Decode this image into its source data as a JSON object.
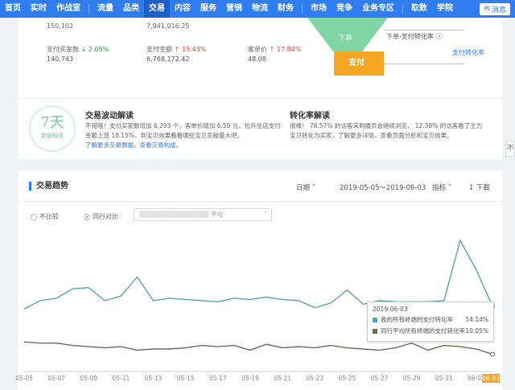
{
  "nav": {
    "items": [
      "首页",
      "实时",
      "作战室",
      "流量",
      "品类",
      "交易",
      "内容",
      "服务",
      "营销",
      "物流",
      "财务",
      "市场",
      "竞争",
      "业务专区",
      "取数",
      "学院"
    ],
    "active": "交易",
    "message_label": "消息"
  },
  "summary": {
    "top_values": [
      "150,102",
      "7,941,016.25"
    ],
    "metrics": [
      {
        "label": "支付买家数",
        "change": "2.05%",
        "dir": "down",
        "value": "140,743"
      },
      {
        "label": "支付金额",
        "change": "15.43%",
        "dir": "up",
        "value": "6,768,172.42"
      },
      {
        "label": "客单价",
        "change": "17.84%",
        "dir": "up",
        "value": "48.08"
      }
    ],
    "funnel_top_label": "下单",
    "funnel_pay_label": "支付",
    "order_pay_rate_label": "下单-支付转化率",
    "pay_rate_label": "支付转化率"
  },
  "insights": {
    "badge_big": "7天",
    "badge_small": "数据解读",
    "trade_title": "交易波动解读",
    "trade_lines": [
      "不错哦！支付买家数增加 6,293 个，客单价增加 6.59 元，拉升全店支付",
      "金额上涨 18.15%，到宝贝效果看看哪些宝贝贡献最大吧。",
      "了解更多交易数据，查看交易构成。"
    ],
    "conv_title": "转化率解读",
    "conv_lines": [
      "很棒！ 78.57% 的访客来到播页会继续浏览， 12.38% 的访客看了主力",
      "宝贝转化为买家，了解更多详情，查看页面分析和宝贝效果。"
    ]
  },
  "trend": {
    "title": "交易趋势",
    "date_label": "日期",
    "date_range": "2019-05-05～2019-06-03",
    "metric_label": "指标",
    "download_label": "下载",
    "radio_none": "不比较",
    "radio_peer": "同行对比",
    "select_suffix": "平均",
    "tooltip": {
      "date": "2019-06-03",
      "rows": [
        {
          "name": "我的所有终端的支付转化率",
          "value": "14.14%",
          "color": "#5aa3ad"
        },
        {
          "name": "同行平均所有终端的支付转化率",
          "value": "10.05%",
          "color": "#6b6b5a"
        }
      ]
    }
  },
  "chart_data": {
    "type": "line",
    "x": [
      "05-05",
      "05-06",
      "05-07",
      "05-08",
      "05-09",
      "05-10",
      "05-11",
      "05-12",
      "05-13",
      "05-14",
      "05-15",
      "05-16",
      "05-17",
      "05-18",
      "05-19",
      "05-20",
      "05-21",
      "05-22",
      "05-23",
      "05-24",
      "05-25",
      "05-26",
      "05-27",
      "05-28",
      "05-29",
      "05-30",
      "05-31",
      "06-01",
      "06-02",
      "06-03"
    ],
    "x_tick_labels": [
      "05-05",
      "05-07",
      "05-09",
      "05-11",
      "05-13",
      "05-15",
      "05-17",
      "05-19",
      "05-21",
      "05-23",
      "05-25",
      "05-27",
      "05-29",
      "05-31",
      "06-02",
      "06-03"
    ],
    "series": [
      {
        "name": "我的所有终端的支付转化率",
        "color": "#5aa3ad",
        "values": [
          13.9,
          14.6,
          14.8,
          15.6,
          15.7,
          14.6,
          15.0,
          16.6,
          14.6,
          14.8,
          14.7,
          14.6,
          14.5,
          14.8,
          14.7,
          14.9,
          14.7,
          14.6,
          14.0,
          14.4,
          15.5,
          14.3,
          14.6,
          14.5,
          14.5,
          14.5,
          14.6,
          19.7,
          17.2,
          14.14
        ]
      },
      {
        "name": "同行平均所有终端的支付转化率",
        "color": "#6b6b5a",
        "values": [
          11.1,
          11.0,
          11.0,
          10.8,
          10.7,
          10.6,
          10.7,
          10.4,
          10.5,
          10.5,
          10.6,
          10.8,
          10.7,
          10.8,
          10.4,
          10.9,
          10.6,
          10.7,
          10.6,
          10.8,
          10.6,
          10.5,
          10.4,
          10.6,
          11.0,
          10.4,
          10.8,
          10.7,
          10.5,
          10.05
        ]
      }
    ],
    "ylim": [
      9,
      21
    ],
    "grid": false
  }
}
